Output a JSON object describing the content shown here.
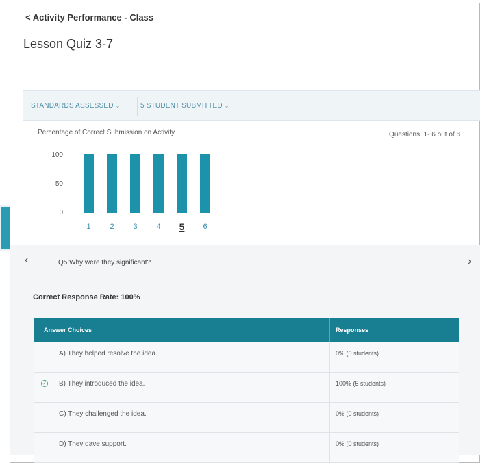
{
  "header": {
    "back_link": "< Activity Performance - Class",
    "title": "Lesson Quiz 3-7"
  },
  "filters": [
    {
      "label": "STANDARDS ASSESSED"
    },
    {
      "label": "5 STUDENT SUBMITTED"
    }
  ],
  "chart_caption": "Percentage of Correct Submission on Activity",
  "questions_count": "Questions: 1- 6 out of 6",
  "chart_data": {
    "type": "bar",
    "categories": [
      "1",
      "2",
      "3",
      "4",
      "5",
      "6"
    ],
    "values": [
      100,
      100,
      100,
      100,
      100,
      100
    ],
    "title": "Percentage of Correct Submission on Activity",
    "xlabel": "",
    "ylabel": "",
    "ylim": [
      0,
      100
    ],
    "yticks": [
      "100",
      "50",
      "0"
    ],
    "selected_category": "5",
    "bar_color": "#1c93ab"
  },
  "question": {
    "text": "Q5:Why were they significant?",
    "correct_rate": "Correct Response Rate: 100%"
  },
  "table": {
    "headers": [
      "Answer Choices",
      "Responses"
    ],
    "rows": [
      {
        "choice": "A) They helped resolve the idea.",
        "responses": "0% (0 students)",
        "correct": false
      },
      {
        "choice": "B) They introduced the idea.",
        "responses": "100% (5 students)",
        "correct": true
      },
      {
        "choice": "C) They challenged the idea.",
        "responses": "0% (0 students)",
        "correct": false
      },
      {
        "choice": "D) They gave support.",
        "responses": "0% (0 students)",
        "correct": false
      }
    ]
  },
  "icons": {
    "filter_chevron": "chevron-down-icon",
    "prev": "chevron-left-icon",
    "next": "chevron-right-icon",
    "correct": "check-circle-icon"
  },
  "colors": {
    "accent": "#1c93ab",
    "table_header": "#187e92",
    "side_tab": "#2a9bb3",
    "correct": "#3aa26a"
  }
}
